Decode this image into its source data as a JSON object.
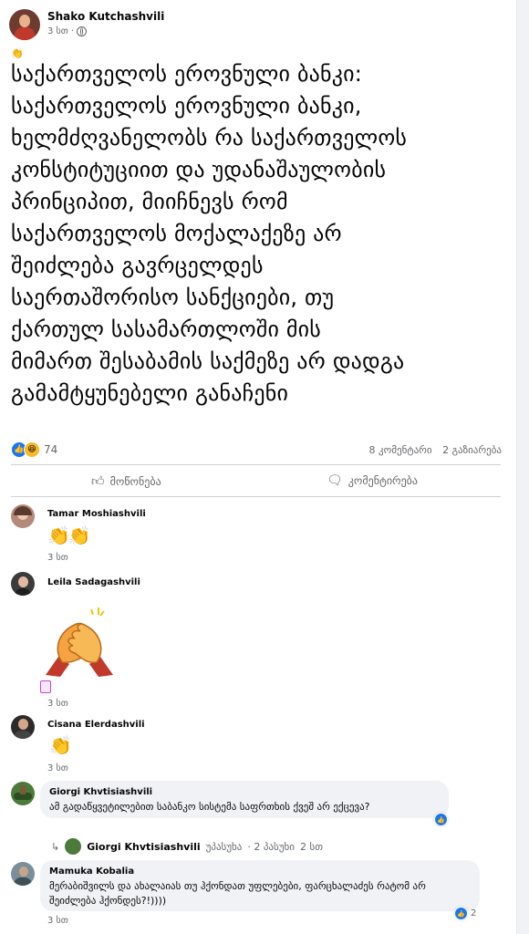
{
  "post": {
    "author": "Shako Kutchashvili",
    "time": "3 სთ",
    "lead_emoji": "👏",
    "text": "საქართველოს ეროვნული ბანკი:\nსაქართველოს ეროვნული ბანკი,\nხელმძღვანელობს რა საქართველოს\nკონსტიტუციით და უდანაშაულობის\nპრინციპით, მიიჩნევს რომ\nსაქართველოს მოქალაქეზე არ\nშეიძლება გავრცელდეს\nსაერთაშორისო სანქციები, თუ\nქართულ სასამართლოში მის\nმიმართ შესაბამის საქმეზე არ დადგა\nგამამტყუნებელი განაჩენი",
    "reaction_count": "74",
    "comments_count": "8 კომენტარი",
    "shares_count": "2 გაზიარება",
    "like_label": "მოწონება",
    "comment_label": "კომენტირება"
  },
  "comments": [
    {
      "name": "Tamar Moshiashvili",
      "content": "👏👏",
      "time": "3 სთ"
    },
    {
      "name": "Leila Sadagashvili",
      "time": "3 სთ"
    },
    {
      "name": "Cisana Elerdashvili",
      "content": "👏",
      "time": "3 სთ"
    },
    {
      "name": "Giorgi Khvtisiashvili",
      "content": "ამ გადაწყვეტილებით საბანკო სისტემა საფრთხის ქვეშ არ ექცევა?"
    },
    {
      "name": "Mamuka Kobalia",
      "content": "მერაბიშვილს და ახალაიას თუ ჰქონდათ უფლებები, ფარცხალაძეს რატომ არ შეიძლება ჰქონდეს?!))))",
      "time": "3 სთ",
      "reactions": "2"
    }
  ],
  "reply": {
    "name": "Giorgi Khvtisiashvili",
    "action": "უპასუხა",
    "summary": "· 2 პასუხი",
    "time": "2 სთ"
  },
  "colors": {
    "accent": "#1877f2",
    "secondary_text": "#65676b",
    "bubble": "#f0f2f5"
  }
}
